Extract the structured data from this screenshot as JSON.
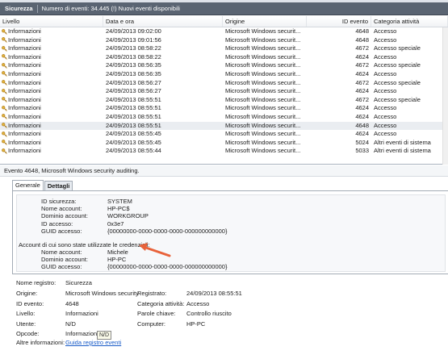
{
  "header": {
    "title": "Sicurezza",
    "count_text": "Numero di eventi: 34.445 (!) Nuovi eventi disponibili"
  },
  "columns": [
    "Livello",
    "Data e ora",
    "Origine",
    "ID evento",
    "Categoria attività"
  ],
  "rows": [
    {
      "level": "Informazioni",
      "date": "24/09/2013 09:02:00",
      "source": "Microsoft Windows securit...",
      "id": "4648",
      "category": "Accesso"
    },
    {
      "level": "Informazioni",
      "date": "24/09/2013 09:01:56",
      "source": "Microsoft Windows securit...",
      "id": "4648",
      "category": "Accesso"
    },
    {
      "level": "Informazioni",
      "date": "24/09/2013 08:58:22",
      "source": "Microsoft Windows securit...",
      "id": "4672",
      "category": "Accesso speciale"
    },
    {
      "level": "Informazioni",
      "date": "24/09/2013 08:58:22",
      "source": "Microsoft Windows securit...",
      "id": "4624",
      "category": "Accesso"
    },
    {
      "level": "Informazioni",
      "date": "24/09/2013 08:56:35",
      "source": "Microsoft Windows securit...",
      "id": "4672",
      "category": "Accesso speciale"
    },
    {
      "level": "Informazioni",
      "date": "24/09/2013 08:56:35",
      "source": "Microsoft Windows securit...",
      "id": "4624",
      "category": "Accesso"
    },
    {
      "level": "Informazioni",
      "date": "24/09/2013 08:56:27",
      "source": "Microsoft Windows securit...",
      "id": "4672",
      "category": "Accesso speciale"
    },
    {
      "level": "Informazioni",
      "date": "24/09/2013 08:56:27",
      "source": "Microsoft Windows securit...",
      "id": "4624",
      "category": "Accesso"
    },
    {
      "level": "Informazioni",
      "date": "24/09/2013 08:55:51",
      "source": "Microsoft Windows securit...",
      "id": "4672",
      "category": "Accesso speciale"
    },
    {
      "level": "Informazioni",
      "date": "24/09/2013 08:55:51",
      "source": "Microsoft Windows securit...",
      "id": "4624",
      "category": "Accesso"
    },
    {
      "level": "Informazioni",
      "date": "24/09/2013 08:55:51",
      "source": "Microsoft Windows securit...",
      "id": "4624",
      "category": "Accesso"
    },
    {
      "level": "Informazioni",
      "date": "24/09/2013 08:55:51",
      "source": "Microsoft Windows securit...",
      "id": "4648",
      "category": "Accesso"
    },
    {
      "level": "Informazioni",
      "date": "24/09/2013 08:55:45",
      "source": "Microsoft Windows securit...",
      "id": "4624",
      "category": "Accesso"
    },
    {
      "level": "Informazioni",
      "date": "24/09/2013 08:55:45",
      "source": "Microsoft Windows securit...",
      "id": "5024",
      "category": "Altri eventi di sistema"
    },
    {
      "level": "Informazioni",
      "date": "24/09/2013 08:55:44",
      "source": "Microsoft Windows securit...",
      "id": "5033",
      "category": "Altri eventi di sistema"
    }
  ],
  "selected_row": 11,
  "detail": {
    "title": "Evento 4648, Microsoft Windows security auditing.",
    "tab_general": "Generale",
    "tab_details": "Dettagli",
    "subject": [
      {
        "k": "ID sicurezza:",
        "v": "SYSTEM"
      },
      {
        "k": "Nome account:",
        "v": "HP-PC$"
      },
      {
        "k": "Dominio account:",
        "v": "WORKGROUP"
      },
      {
        "k": "ID accesso:",
        "v": "0x3e7"
      },
      {
        "k": "GUID accesso:",
        "v": "{00000000-0000-0000-0000-000000000000}"
      }
    ],
    "credentials_heading": "Account di cui sono state utilizzate le credenziali:",
    "credentials": [
      {
        "k": "Nome account:",
        "v": "Michele"
      },
      {
        "k": "Dominio account:",
        "v": "HP-PC"
      },
      {
        "k": "GUID accesso:",
        "v": "{00000000-0000-0000-0000-000000000000}"
      }
    ]
  },
  "props": {
    "registry_k": "Nome registro:",
    "registry_v": "Sicurezza",
    "source_k": "Origine:",
    "source_v": "Microsoft Windows security",
    "logged_k": "Registrato:",
    "logged_v": "24/09/2013 08:55:51",
    "eventid_k": "ID evento:",
    "eventid_v": "4648",
    "taskcat_k": "Categoria attività:",
    "taskcat_v": "Accesso",
    "level_k": "Livello:",
    "level_v": "Informazioni",
    "keywords_k": "Parole chiave:",
    "keywords_v": "Controllo riuscito",
    "user_k": "Utente:",
    "user_v": "N/D",
    "computer_k": "Computer:",
    "computer_v": "HP-PC",
    "opcode_k": "Opcode:",
    "opcode_v": "Informazioni",
    "more_k": "Altre informazioni:",
    "more_link": "Guida registro eventi",
    "tooltip": "N/D"
  },
  "colors": {
    "titlebar": "#5a6472",
    "selected_row": "#eaedf1",
    "arrow": "#e8623a",
    "link": "#1a5cc8"
  }
}
